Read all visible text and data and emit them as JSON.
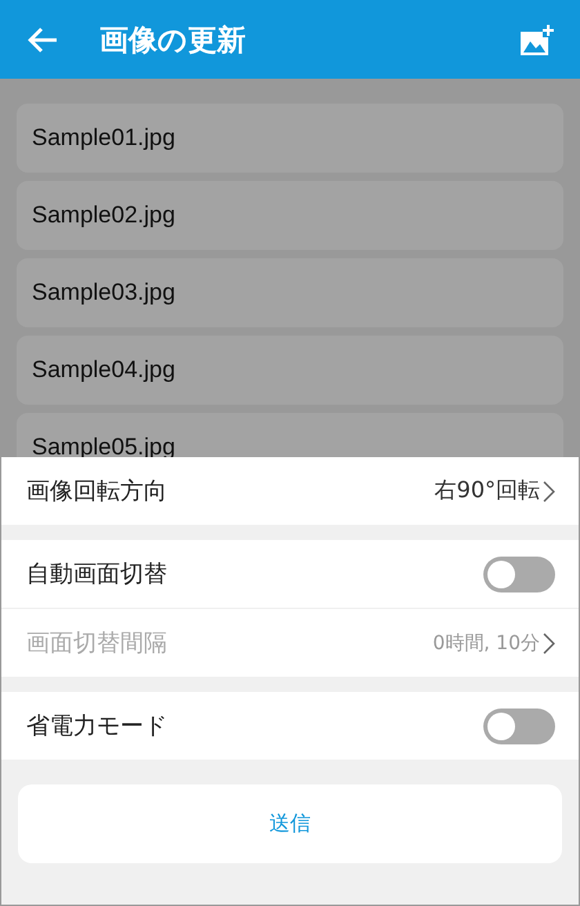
{
  "header": {
    "title": "画像の更新"
  },
  "files": [
    {
      "name": "Sample01.jpg"
    },
    {
      "name": "Sample02.jpg"
    },
    {
      "name": "Sample03.jpg"
    },
    {
      "name": "Sample04.jpg"
    },
    {
      "name": "Sample05.jpg"
    }
  ],
  "settings": [
    [
      {
        "kind": "link",
        "label": "画像回転方向",
        "value": "右90°回転",
        "disabled": false
      }
    ],
    [
      {
        "kind": "toggle",
        "label": "自動画面切替",
        "on": false,
        "disabled": false
      },
      {
        "kind": "link",
        "label": "画面切替間隔",
        "value": "0時間, 10分",
        "disabled": true
      }
    ],
    [
      {
        "kind": "toggle",
        "label": "省電力モード",
        "on": false,
        "disabled": false
      }
    ]
  ],
  "submit_button": "送信"
}
